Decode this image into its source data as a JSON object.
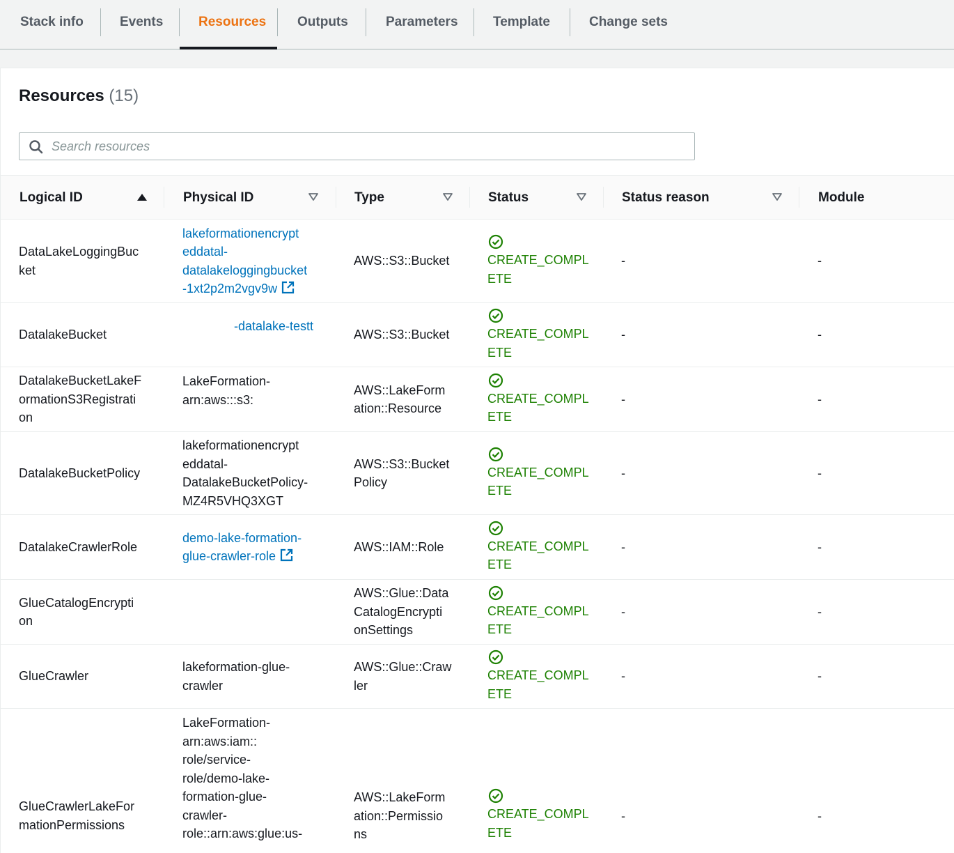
{
  "tabs": [
    {
      "label": "Stack info",
      "active": false
    },
    {
      "label": "Events",
      "active": false
    },
    {
      "label": "Resources",
      "active": true
    },
    {
      "label": "Outputs",
      "active": false
    },
    {
      "label": "Parameters",
      "active": false
    },
    {
      "label": "Template",
      "active": false
    },
    {
      "label": "Change sets",
      "active": false
    }
  ],
  "resources": {
    "title": "Resources",
    "count": "(15)",
    "search_placeholder": "Search resources"
  },
  "columns": {
    "logical_id": "Logical ID",
    "physical_id": "Physical ID",
    "type": "Type",
    "status": "Status",
    "status_reason": "Status reason",
    "module": "Module"
  },
  "rows": [
    {
      "logical_id": "DataLakeLoggingBuc\nket",
      "physical_id": "lakeformationencrypt\neddatal-\ndatalakeloggingbucket\n-1xt2p2m2vgv9w",
      "physical_is_link": true,
      "type": "AWS::S3::Bucket",
      "status": "CREATE_COMPL\nETE",
      "status_reason": "-",
      "module": "-"
    },
    {
      "logical_id": "DatalakeBucket",
      "physical_id": "-datalake-testt",
      "physical_is_link": true,
      "type": "AWS::S3::Bucket",
      "status": "CREATE_COMPL\nETE",
      "status_reason": "-",
      "module": "-"
    },
    {
      "logical_id": "DatalakeBucketLakeF\normationS3Registrati\non",
      "physical_id": "LakeFormation-\narn:aws:::s3:",
      "physical_is_link": false,
      "type": "AWS::LakeForm\nation::Resource",
      "status": "CREATE_COMPL\nETE",
      "status_reason": "-",
      "module": "-"
    },
    {
      "logical_id": "DatalakeBucketPolicy",
      "physical_id": "lakeformationencrypt\neddatal-\nDatalakeBucketPolicy-\nMZ4R5VHQ3XGT",
      "physical_is_link": false,
      "type": "AWS::S3::Bucket\nPolicy",
      "status": "CREATE_COMPL\nETE",
      "status_reason": "-",
      "module": "-"
    },
    {
      "logical_id": "DatalakeCrawlerRole",
      "physical_id": "demo-lake-formation-\nglue-crawler-role",
      "physical_is_link": true,
      "type": "AWS::IAM::Role",
      "status": "CREATE_COMPL\nETE",
      "status_reason": "-",
      "module": "-"
    },
    {
      "logical_id": "GlueCatalogEncrypti\non",
      "physical_id": "",
      "physical_is_link": false,
      "type": "AWS::Glue::Data\nCatalogEncrypti\nonSettings",
      "status": "CREATE_COMPL\nETE",
      "status_reason": "-",
      "module": "-"
    },
    {
      "logical_id": "GlueCrawler",
      "physical_id": "lakeformation-glue-\ncrawler",
      "physical_is_link": false,
      "type": "AWS::Glue::Craw\nler",
      "status": "CREATE_COMPL\nETE",
      "status_reason": "-",
      "module": "-"
    },
    {
      "logical_id": "GlueCrawlerLakeFor\nmationPermissions",
      "physical_id": "LakeFormation-\narn:aws:iam::\n            role/service-\nrole/demo-lake-\nformation-glue-\ncrawler-\nrole::arn:aws:glue:us-",
      "physical_is_link": false,
      "type": "AWS::LakeForm\nation::Permissio\nns",
      "status": "CREATE_COMPL\nETE",
      "status_reason": "-",
      "module": "-"
    }
  ],
  "colors": {
    "accent_tab": "#ec7211",
    "link": "#0073bb",
    "success": "#1d8102"
  },
  "icons": {
    "search": "search-icon",
    "sort_asc": "sort-ascending-icon",
    "sort_filter": "sort-caret-icon",
    "status_ok": "check-circle-icon",
    "external": "external-link-icon"
  }
}
